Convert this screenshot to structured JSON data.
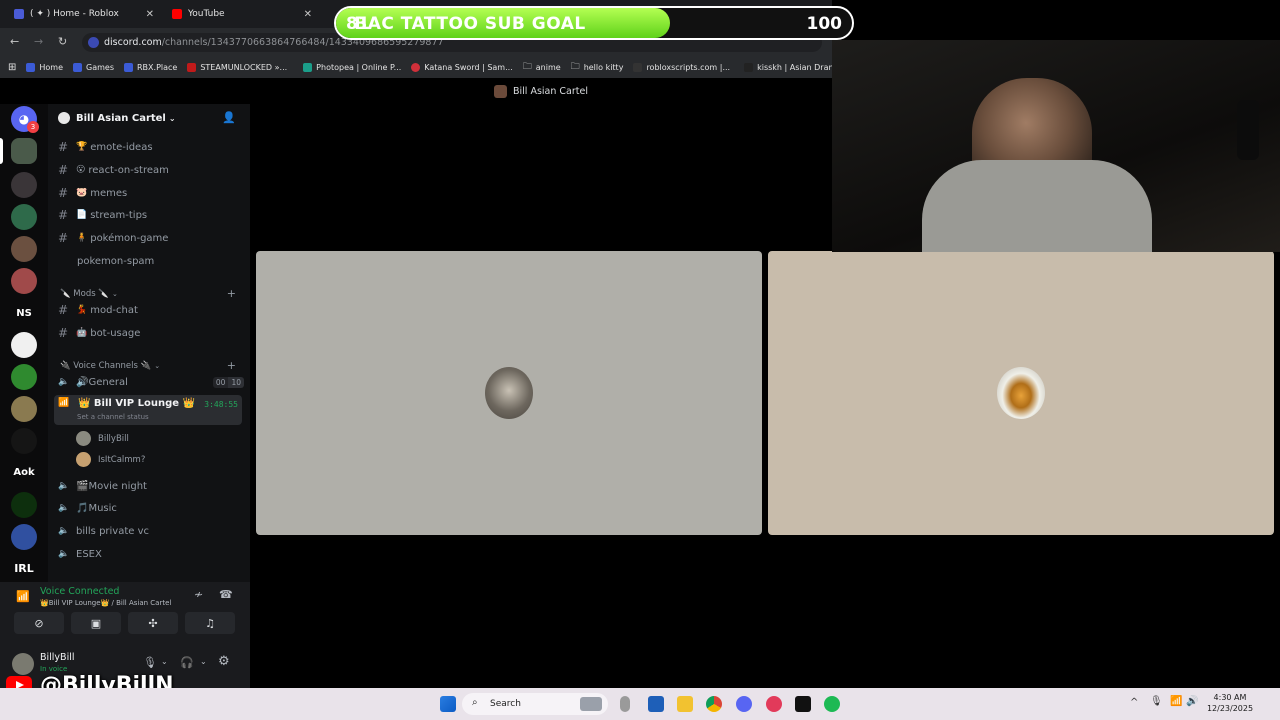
{
  "browser": {
    "tabs": [
      {
        "label": "( ✦ ) Home - Roblox",
        "favicon_color": "#4a5bd6"
      },
      {
        "label": "YouTube",
        "favicon_color": "#ff0000"
      }
    ],
    "url_host": "discord.com",
    "url_path": "/channels/1343770663864766484/1433409686595279877",
    "bookmarks": [
      {
        "label": "Home",
        "color": "#3b5bd6"
      },
      {
        "label": "Games",
        "color": "#3b5bd6"
      },
      {
        "label": "RBX.Place",
        "color": "#3b5bd6"
      },
      {
        "label": "STEAMUNLOCKED »...",
        "color": "#c01a1a"
      },
      {
        "label": "Photopea | Online P...",
        "color": "#1b9e8a"
      },
      {
        "label": "Katana Sword | Sam...",
        "color": "#d0303a"
      },
      {
        "label": "anime",
        "color": "folder"
      },
      {
        "label": "hello kitty",
        "color": "folder"
      },
      {
        "label": "robloxscripts.com |...",
        "color": "#333333"
      },
      {
        "label": "kisskh | Asian Dram...",
        "color": "#222222"
      }
    ]
  },
  "discord": {
    "window_title": "Bill Asian Cartel",
    "server_name": "Bill Asian Cartel",
    "dm_badge": "3",
    "channels": [
      {
        "emoji": "🏆",
        "name": "emote-ideas"
      },
      {
        "emoji": "😮",
        "name": "react-on-stream"
      },
      {
        "emoji": "🐷",
        "name": "memes"
      },
      {
        "emoji": "📄",
        "name": "stream-tips"
      },
      {
        "emoji": "🧍",
        "name": "pokémon-game"
      },
      {
        "emoji": "",
        "name": "pokemon-spam"
      }
    ],
    "mods_category": "🔪 Mods 🔪",
    "mod_channels": [
      {
        "emoji": "💃",
        "name": "mod-chat"
      },
      {
        "emoji": "🤖",
        "name": "bot-usage"
      }
    ],
    "voice_category": "🔌 Voice Channels 🔌",
    "voice_channels": [
      {
        "name": "🔊General",
        "badge1": "00",
        "badge2": "10"
      },
      {
        "name": "👑 Bill VIP Lounge 👑",
        "timer": "3:48:55",
        "status": "Set a channel status"
      },
      {
        "name": "🎬Movie night"
      },
      {
        "name": "🎵Music"
      },
      {
        "name": "bills private vc"
      },
      {
        "name": "ESEX"
      }
    ],
    "voice_members": [
      "BillyBill",
      "IsItCalmm?"
    ],
    "voice_connected": {
      "title": "Voice Connected",
      "subtitle": "👑Bill VIP Lounge👑 / Bill Asian Cartel"
    },
    "user": {
      "name": "BillyBill",
      "status": "In voice"
    },
    "guild_labels": [
      "NS",
      "Aok",
      "IRL"
    ]
  },
  "overlay": {
    "goal_label": "BAC TATTOO SUB GOAL",
    "goal_current": "81",
    "goal_target": "100",
    "goal_progress": 0.81,
    "youtube_handle": "@BillyBillN"
  },
  "taskbar": {
    "search_placeholder": "Search",
    "time": "4:30 AM",
    "date": "12/23/2025"
  }
}
